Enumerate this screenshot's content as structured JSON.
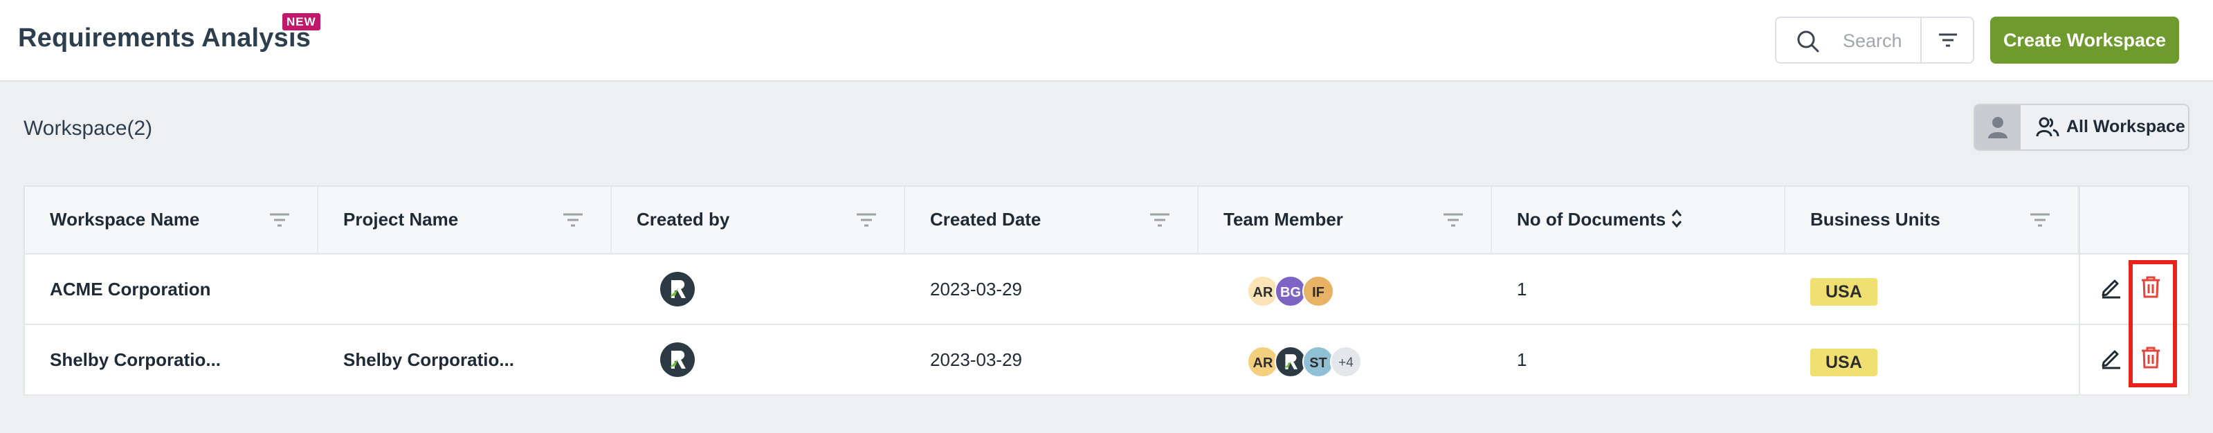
{
  "header": {
    "title": "Requirements Analysis",
    "badge": "NEW",
    "search_placeholder": "Search",
    "filter_icon": "filter-icon",
    "create_button": "Create Workspace"
  },
  "section": {
    "title": "Workspace(2)",
    "toggle_label": "All Workspace"
  },
  "table": {
    "columns": [
      "Workspace Name",
      "Project Name",
      "Created by",
      "Created Date",
      "Team Member",
      "No of Documents",
      "Business Units"
    ],
    "rows": [
      {
        "workspace": "ACME Corporation",
        "project": "",
        "created_date": "2023-03-29",
        "team": [
          "AR",
          "BG",
          "IF"
        ],
        "documents": "1",
        "unit": "USA"
      },
      {
        "workspace": "Shelby Corporatio...",
        "project": "Shelby Corporatio...",
        "created_date": "2023-03-29",
        "team": [
          "AR",
          "",
          "ST",
          "+4"
        ],
        "documents": "1",
        "unit": "USA"
      }
    ]
  },
  "colors": {
    "accent_green": "#6f9a2d",
    "badge_pink": "#c2186b",
    "highlight_red": "#e5241c",
    "unit_yellow": "#efe071",
    "trash_red": "#e5443a"
  }
}
